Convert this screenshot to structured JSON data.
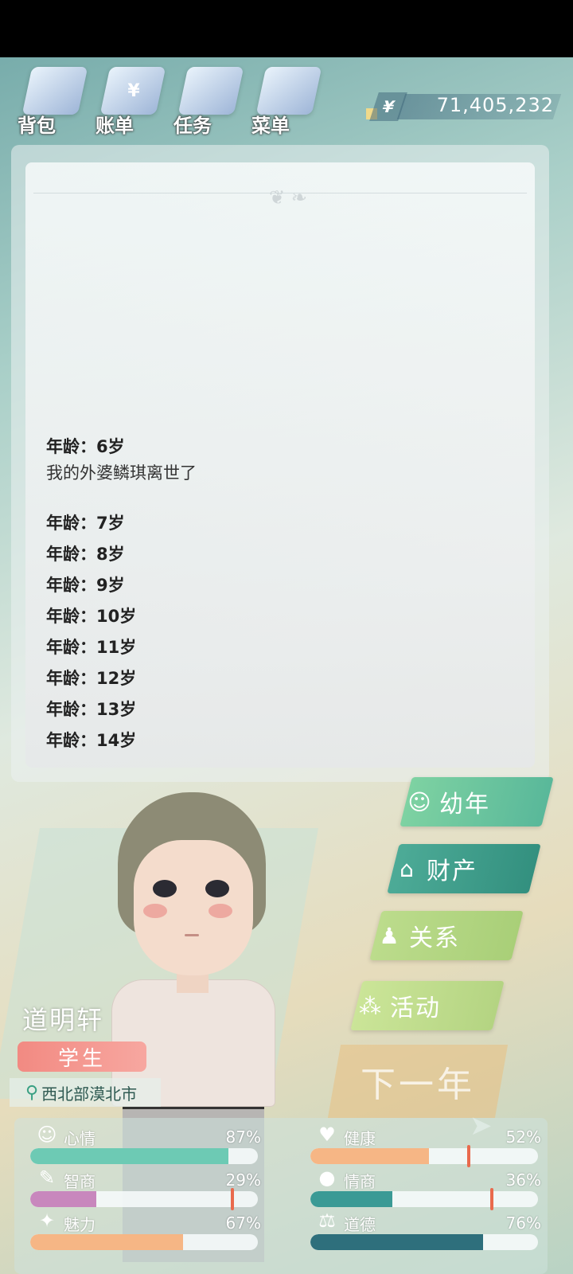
{
  "toolbar": {
    "items": [
      {
        "label": "背包",
        "icon": "bag-icon"
      },
      {
        "label": "账单",
        "icon": "bill-icon",
        "glyph": "¥"
      },
      {
        "label": "任务",
        "icon": "task-icon"
      },
      {
        "label": "菜单",
        "icon": "menu-icon"
      }
    ]
  },
  "money": {
    "symbol": "¥",
    "amount": "71,405,232"
  },
  "log": {
    "entries": [
      {
        "age": "年龄：6岁",
        "event": "我的外婆鳞琪离世了"
      },
      {
        "age": "年龄：7岁"
      },
      {
        "age": "年龄：8岁"
      },
      {
        "age": "年龄：9岁"
      },
      {
        "age": "年龄：10岁"
      },
      {
        "age": "年龄：11岁"
      },
      {
        "age": "年龄：12岁"
      },
      {
        "age": "年龄：13岁"
      },
      {
        "age": "年龄：14岁"
      }
    ]
  },
  "menu": {
    "youth": "幼年",
    "assets": "财产",
    "relations": "关系",
    "activities": "活动",
    "next_year": "下一年"
  },
  "character": {
    "name": "道明轩",
    "role": "学生",
    "location": "西北部漠北市"
  },
  "stats": [
    {
      "name": "心情",
      "value": "87%",
      "fraction": 0.87,
      "color": "#6dcab4",
      "icon": "smile-icon",
      "glyph": "☺"
    },
    {
      "name": "健康",
      "value": "52%",
      "fraction": 0.52,
      "color": "#f6b685",
      "icon": "heart-icon",
      "glyph": "♥",
      "marker": 0.69
    },
    {
      "name": "智商",
      "value": "29%",
      "fraction": 0.29,
      "color": "#c887bd",
      "icon": "bulb-icon",
      "glyph": "✎",
      "marker": 0.88
    },
    {
      "name": "情商",
      "value": "36%",
      "fraction": 0.36,
      "color": "#3a9a95",
      "icon": "apple-icon",
      "glyph": "●",
      "marker": 0.79
    },
    {
      "name": "魅力",
      "value": "67%",
      "fraction": 0.67,
      "color": "#f6b685",
      "icon": "sparkle-icon",
      "glyph": "✦"
    },
    {
      "name": "道德",
      "value": "76%",
      "fraction": 0.76,
      "color": "#2e6f7c",
      "icon": "scale-icon",
      "glyph": "⚖"
    }
  ]
}
